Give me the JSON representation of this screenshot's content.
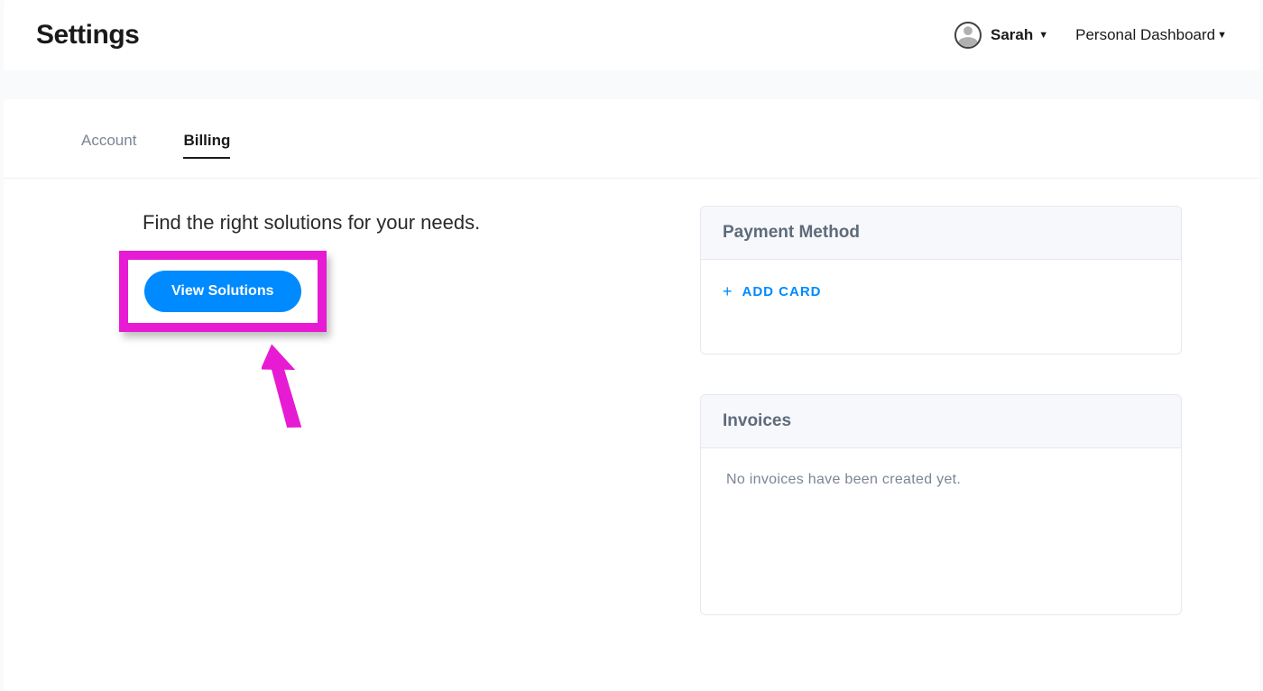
{
  "header": {
    "title": "Settings",
    "user_name": "Sarah",
    "dashboard_label": "Personal Dashboard"
  },
  "tabs": {
    "account": "Account",
    "billing": "Billing"
  },
  "left": {
    "prompt": "Find the right solutions for your needs.",
    "view_solutions_label": "View Solutions"
  },
  "right": {
    "payment_header": "Payment Method",
    "add_card_label": "ADD CARD",
    "invoices_header": "Invoices",
    "invoices_empty": "No invoices have been created yet."
  }
}
